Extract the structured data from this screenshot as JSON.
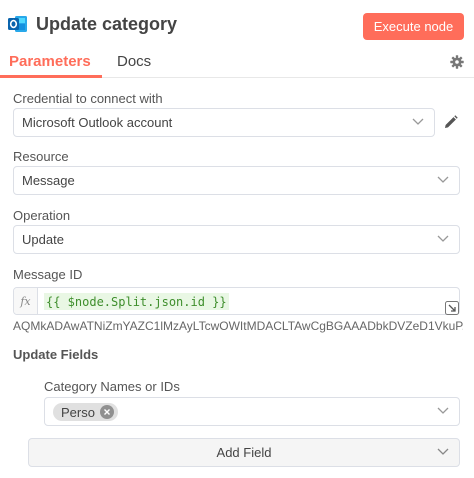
{
  "header": {
    "app_icon": "outlook-icon",
    "title": "Update category",
    "execute_label": "Execute node",
    "accent": "#ff6d5a"
  },
  "tabs": [
    {
      "label": "Parameters",
      "active": true
    },
    {
      "label": "Docs",
      "active": false
    }
  ],
  "settings_icon": "gear-icon",
  "credential": {
    "label": "Credential to connect with",
    "value": "Microsoft Outlook account",
    "edit_icon": "pencil-icon"
  },
  "resource": {
    "label": "Resource",
    "value": "Message"
  },
  "operation": {
    "label": "Operation",
    "value": "Update"
  },
  "message_id": {
    "label": "Message ID",
    "fx_label": "fx",
    "expression": "{{ $node.Split.json.id }}",
    "resolved_value": "AQMkADAwATNiZmYAZC1lMzAyLTcwOWItMDACLTAwCgBGAAADbkDVZeD1VkuP..."
  },
  "update_fields": {
    "title": "Update Fields",
    "category": {
      "label": "Category Names or IDs",
      "tags": [
        "Perso"
      ]
    },
    "add_field_label": "Add Field"
  }
}
